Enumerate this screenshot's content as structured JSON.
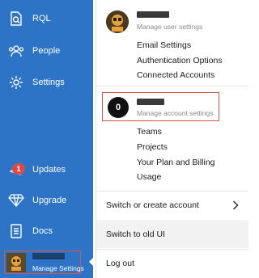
{
  "sidebar": {
    "items": [
      {
        "label": "RQL",
        "icon": "rql-search-icon"
      },
      {
        "label": "People",
        "icon": "people-icon"
      },
      {
        "label": "Settings",
        "icon": "gear-icon"
      },
      {
        "label": "Updates",
        "icon": "updates-icon",
        "badge": "1"
      },
      {
        "label": "Upgrade",
        "icon": "diamond-icon"
      },
      {
        "label": "Docs",
        "icon": "document-icon"
      }
    ],
    "user": {
      "subtitle": "Manage Settings"
    }
  },
  "menu": {
    "user_subtitle": "Manage user settings",
    "user_links": [
      "Email Settings",
      "Authentication Options",
      "Connected Accounts"
    ],
    "account_initial": "0",
    "account_subtitle": "Manage account settings",
    "account_links": [
      "Teams",
      "Projects",
      "Your Plan and Billing",
      "Usage"
    ],
    "switch_account": "Switch or create account",
    "old_ui": "Switch to old UI",
    "logout": "Log out"
  },
  "colors": {
    "sidebar": "#2e74c6",
    "highlight_box": "#d9534f",
    "badge": "#d94a4a"
  }
}
